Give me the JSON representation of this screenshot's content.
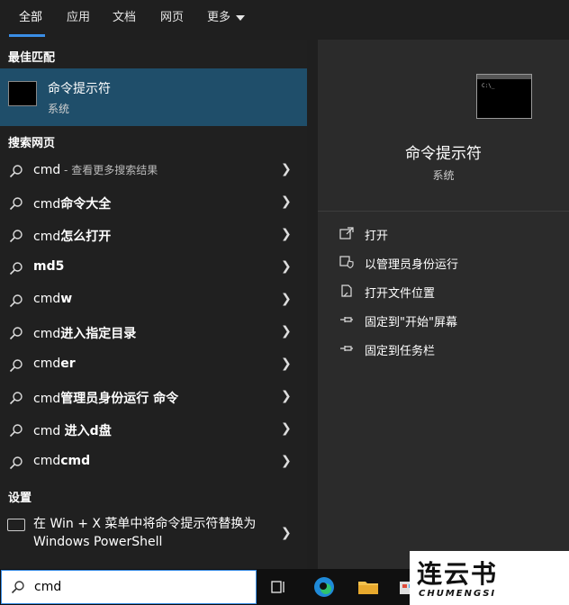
{
  "tabs": [
    {
      "label": "全部"
    },
    {
      "label": "应用"
    },
    {
      "label": "文档"
    },
    {
      "label": "网页"
    },
    {
      "label": "更多"
    }
  ],
  "best_match": {
    "section_title": "最佳匹配",
    "title": "命令提示符",
    "subtitle": "系统"
  },
  "web": {
    "section_title": "搜索网页",
    "items": [
      {
        "main": "cmd",
        "suffix": " - 查看更多搜索结果",
        "bold": ""
      },
      {
        "main": "cmd",
        "suffix": "",
        "bold": "命令大全"
      },
      {
        "main": "cmd",
        "suffix": "",
        "bold": "怎么打开"
      },
      {
        "main": "",
        "suffix": "",
        "bold": "md5"
      },
      {
        "main": "cmd",
        "suffix": "",
        "bold": "w"
      },
      {
        "main": "cmd",
        "suffix": "",
        "bold": "进入指定目录"
      },
      {
        "main": "cmd",
        "suffix": "",
        "bold": "er"
      },
      {
        "main": "cmd",
        "suffix": "",
        "bold": "管理员身份运行 命令"
      },
      {
        "main": "cmd ",
        "suffix": "",
        "bold": "进入d盘"
      },
      {
        "main": "cmd",
        "suffix": "",
        "bold": "cmd"
      }
    ]
  },
  "settings": {
    "section_title": "设置",
    "item_label": "在 Win + X 菜单中将命令提示符替换为 Windows PowerShell"
  },
  "preview": {
    "title": "命令提示符",
    "subtitle": "系统",
    "actions": [
      {
        "label": "打开",
        "icon": "open-icon"
      },
      {
        "label": "以管理员身份运行",
        "icon": "shield-icon"
      },
      {
        "label": "打开文件位置",
        "icon": "file-location-icon"
      },
      {
        "label": "固定到\"开始\"屏幕",
        "icon": "pin-icon"
      },
      {
        "label": "固定到任务栏",
        "icon": "pin-icon"
      }
    ]
  },
  "search": {
    "value": "cmd"
  },
  "watermark": {
    "main": "连云书",
    "sub": "CHUMENGSI"
  },
  "colors": {
    "accent": "#3a8ee6",
    "highlight": "#1f4e6a"
  }
}
